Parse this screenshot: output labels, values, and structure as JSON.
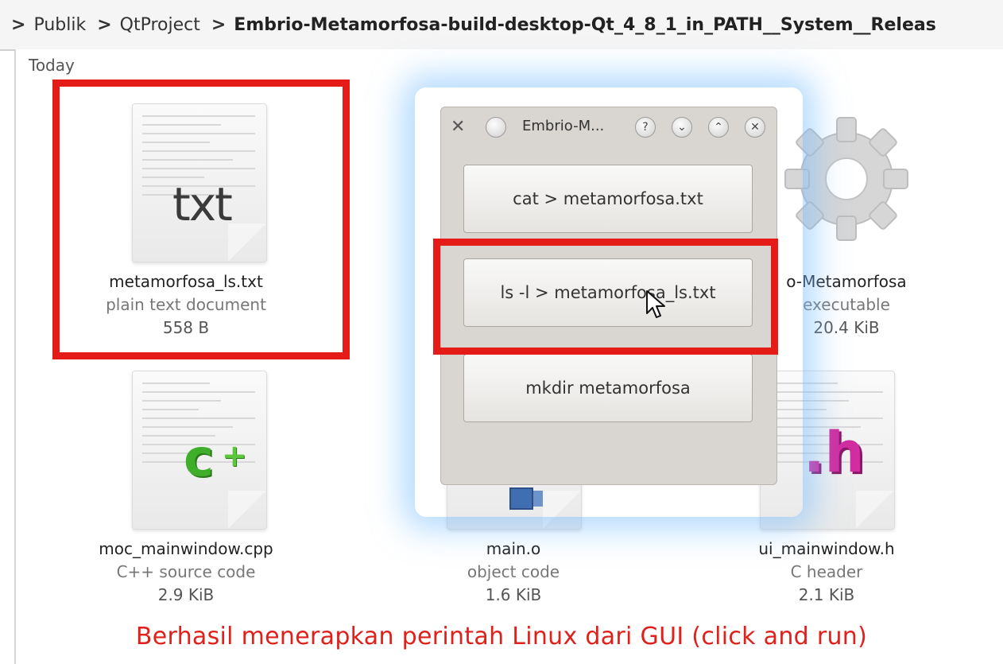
{
  "breadcrumb": {
    "items": [
      "Publik",
      "QtProject",
      "Embrio-Metamorfosa-build-desktop-Qt_4_8_1_in_PATH__System__Releas"
    ]
  },
  "view": {
    "group_title": "Today",
    "files": [
      {
        "name": "metamorfosa_ls.txt",
        "type": "plain text document",
        "size": "558 B",
        "icon": "text-document-icon",
        "icon_text": "txt"
      },
      {
        "name": "o-Metamorfosa",
        "type": "executable",
        "size": "20.4 KiB",
        "icon": "gear-executable-icon"
      },
      {
        "name": "moc_mainwindow.cpp",
        "type": "C++ source code",
        "size": "2.9 KiB",
        "icon": "cpp-source-icon"
      },
      {
        "name": "main.o",
        "type": "object code",
        "size": "1.6 KiB",
        "icon": "object-file-icon"
      },
      {
        "name": "ui_mainwindow.h",
        "type": "C header",
        "size": "2.1 KiB",
        "icon": "c-header-icon",
        "icon_text": ".h"
      }
    ]
  },
  "dialog": {
    "title": "Embrio-M...",
    "title_buttons": [
      "?",
      "⌄",
      "⌃",
      "✕"
    ],
    "buttons": [
      "cat > metamorfosa.txt",
      "ls -l > metamorfosa_ls.txt",
      "mkdir metamorfosa"
    ]
  },
  "caption": "Berhasil menerapkan perintah Linux dari GUI (click and run)",
  "colors": {
    "highlight": "#e41b17",
    "caption": "#e0201a",
    "glow": "#78beff"
  }
}
